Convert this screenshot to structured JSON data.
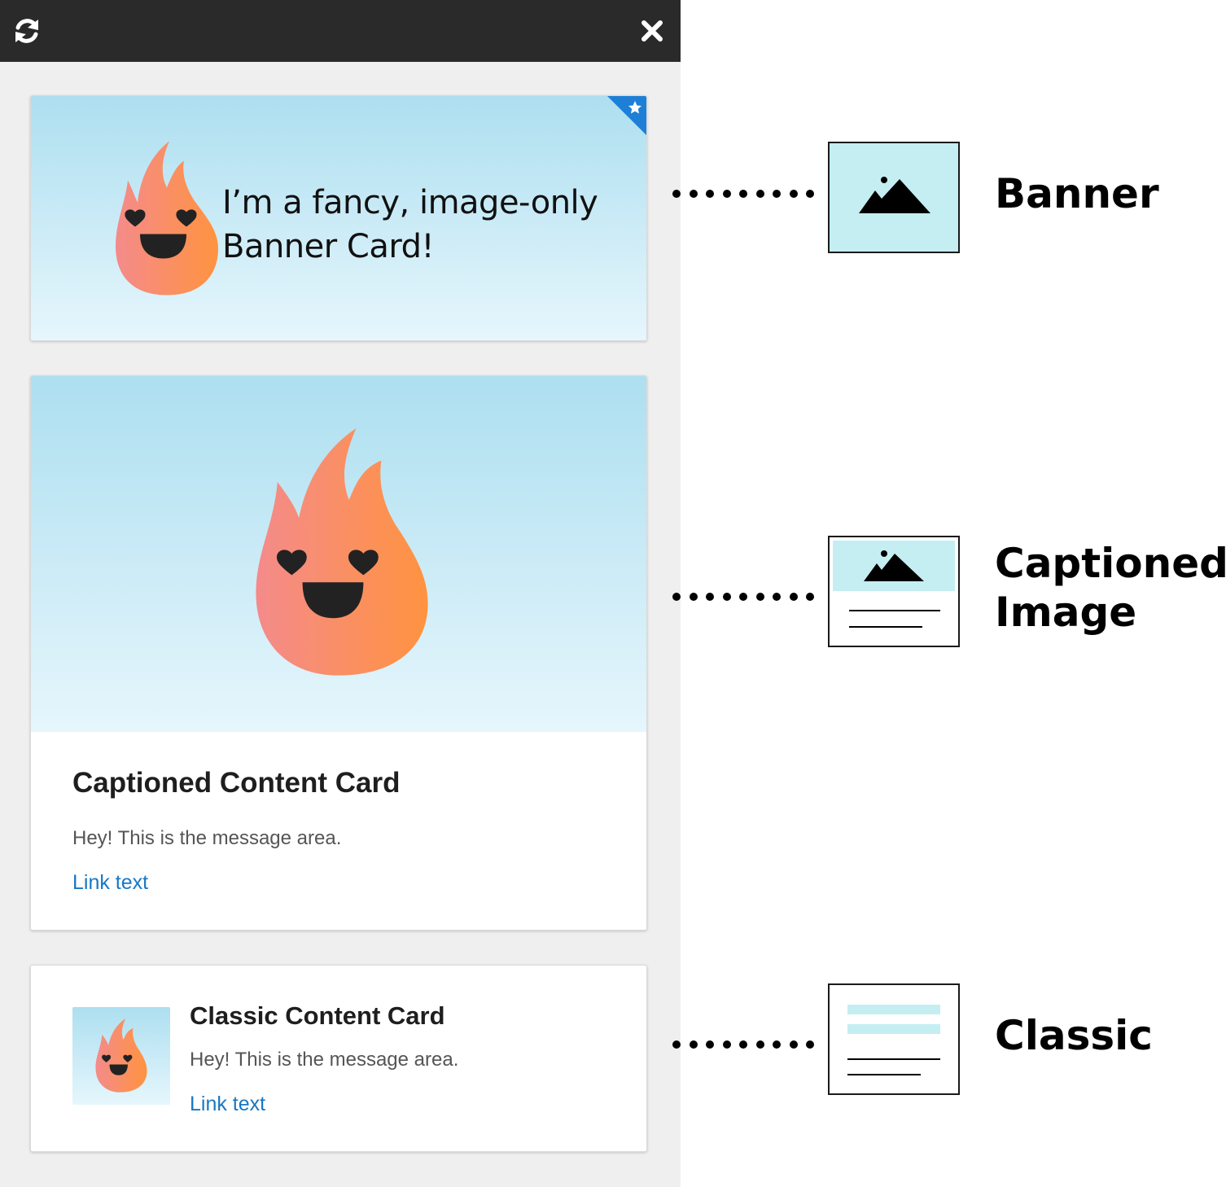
{
  "toolbar": {
    "refresh_icon": "refresh-icon",
    "close_icon": "close-icon"
  },
  "cards": {
    "banner": {
      "text_line1": "I’m a fancy, image-only",
      "text_line2": "Banner Card!",
      "pinned": true
    },
    "captioned": {
      "title": "Captioned Content Card",
      "message": "Hey! This is the message area.",
      "link": "Link text"
    },
    "classic": {
      "title": "Classic Content Card",
      "message": "Hey! This is the message area.",
      "link": "Link text"
    }
  },
  "legend": {
    "banner_label": "Banner",
    "captioned_label_line1": "Captioned",
    "captioned_label_line2": "Image",
    "classic_label": "Classic"
  },
  "colors": {
    "sky_top": "#addff0",
    "sky_bottom": "#e6f6fc",
    "flame_left": "#f48b8b",
    "flame_right": "#ff9340",
    "link": "#1877c5",
    "pin": "#1e7fd6",
    "legend_fill": "#c4eef2"
  }
}
